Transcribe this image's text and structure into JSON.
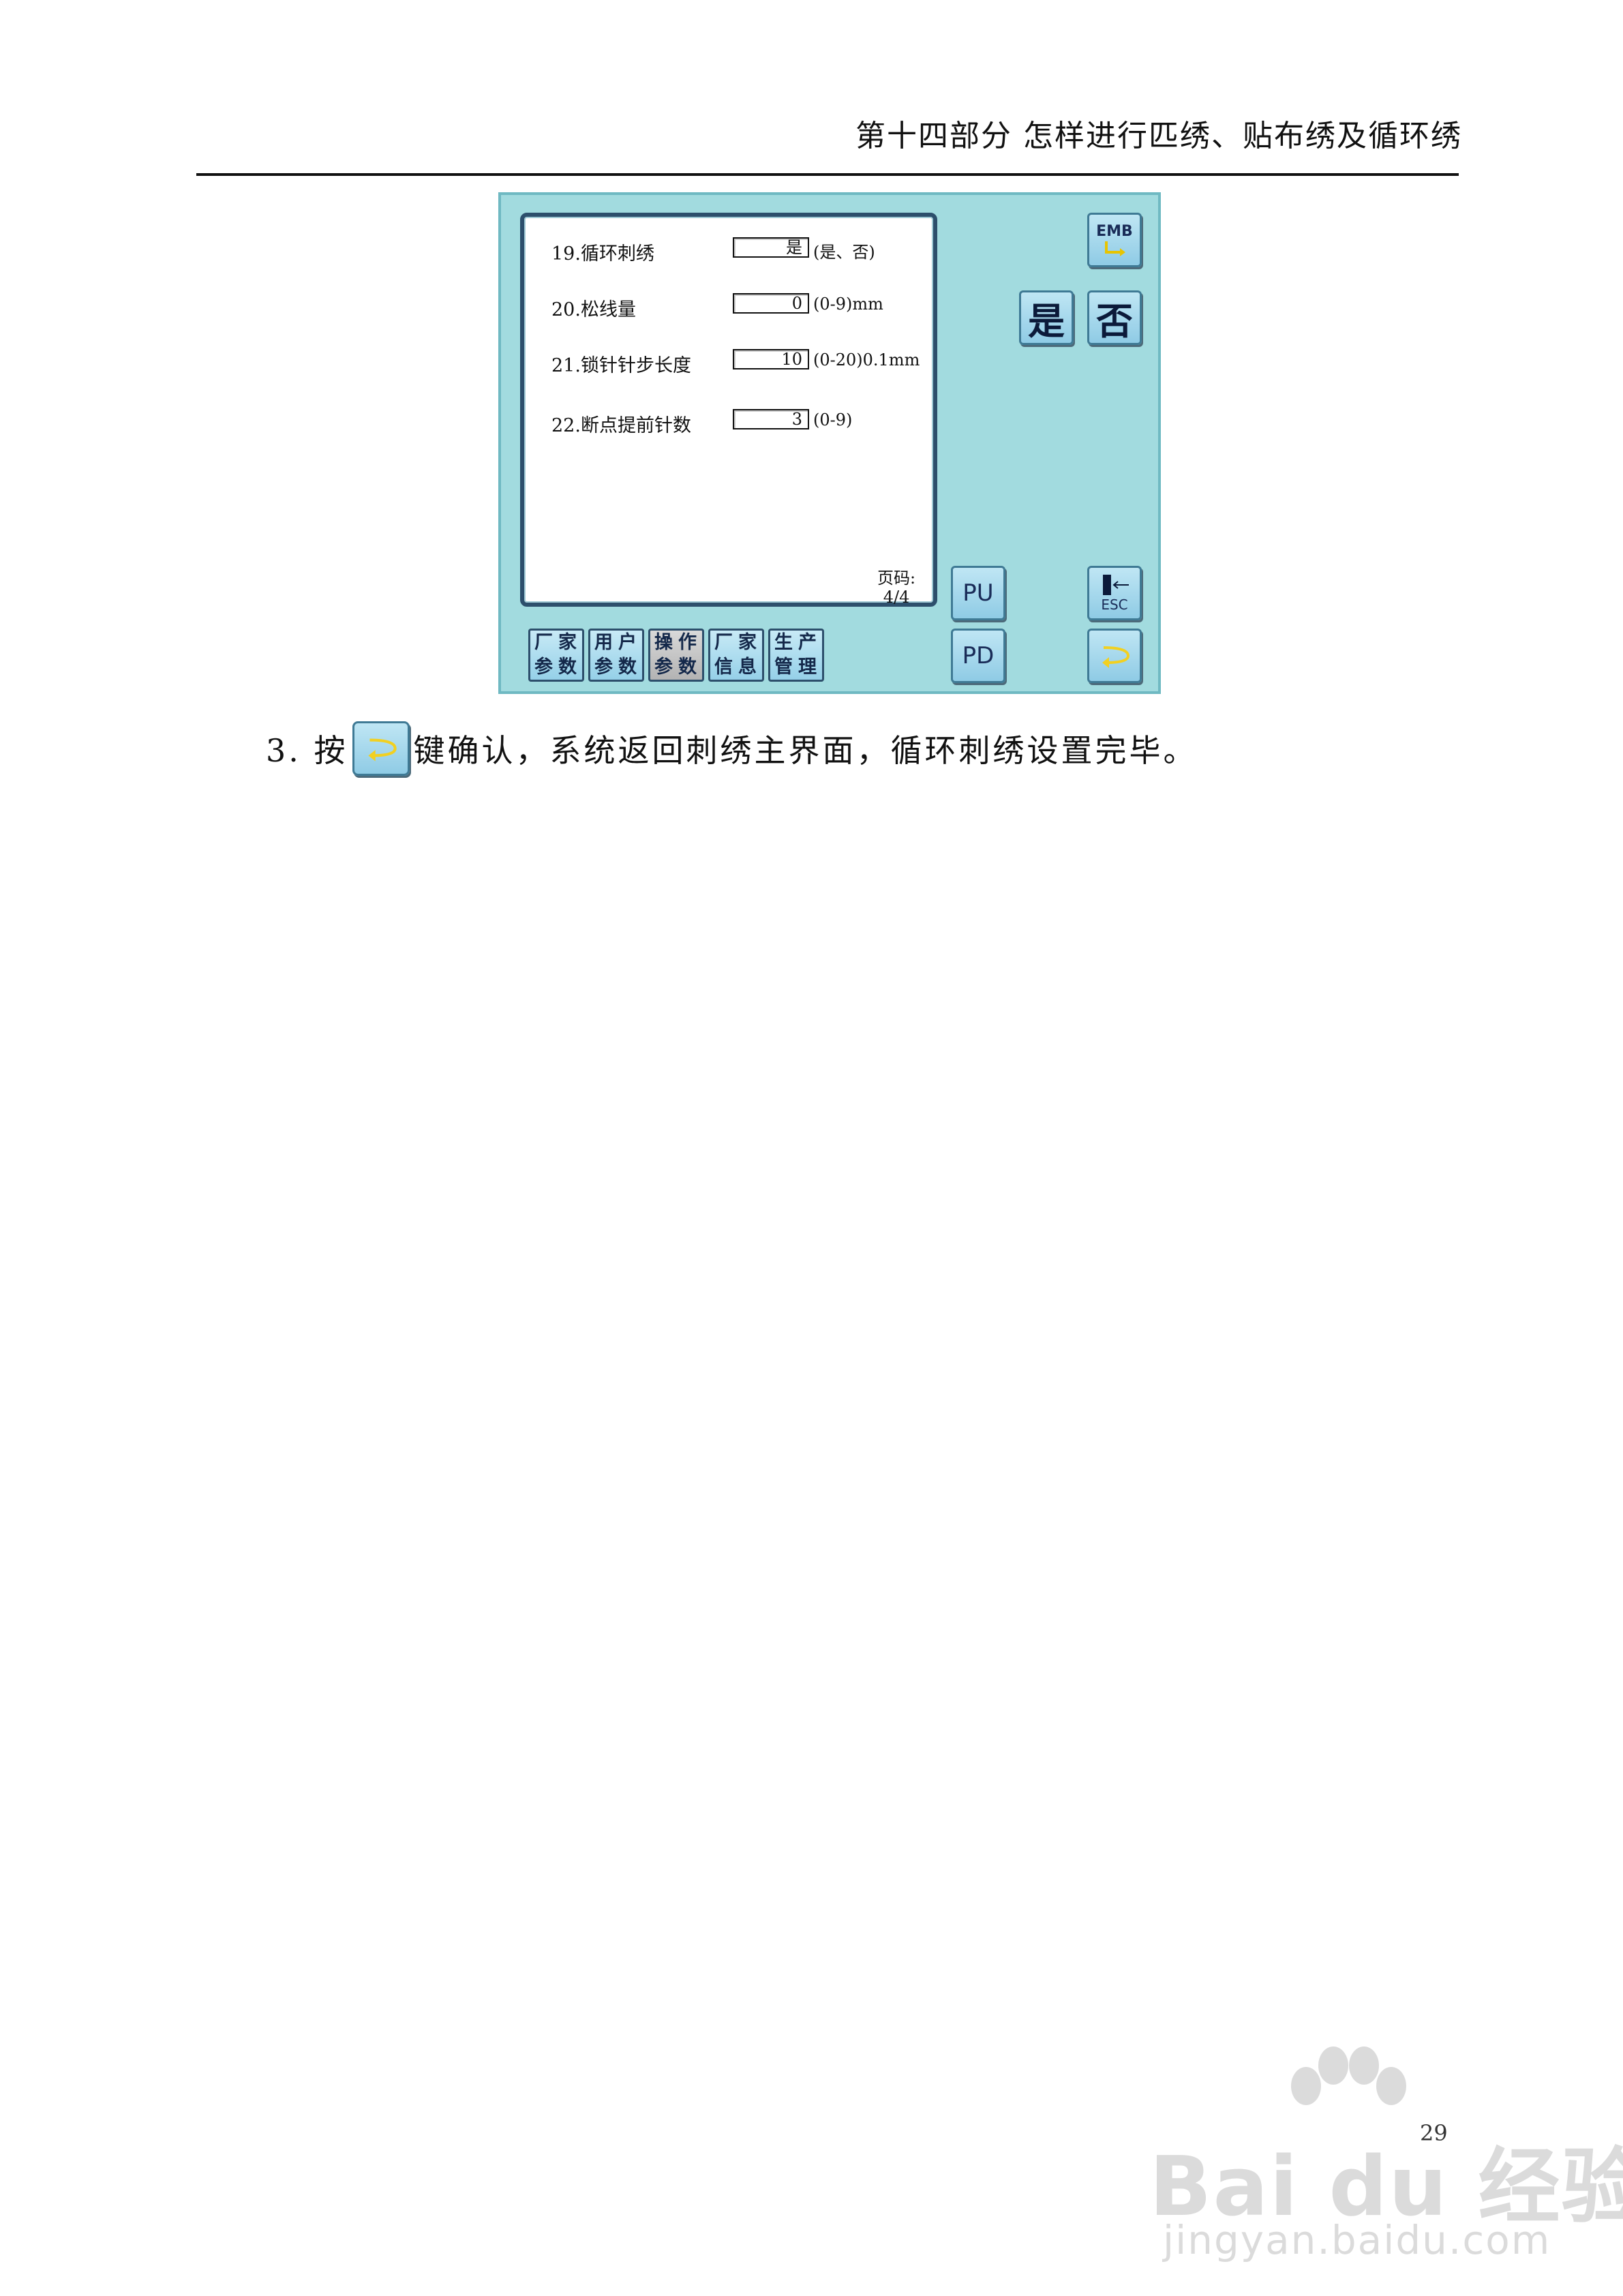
{
  "header": {
    "title": "第十四部分   怎样进行匹绣、贴布绣及循环绣"
  },
  "screen": {
    "params": [
      {
        "label": "19.循环刺绣",
        "value": "是",
        "range": "(是、否)"
      },
      {
        "label": "20.松线量",
        "value": "0",
        "range": "(0-9)mm"
      },
      {
        "label": "21.锁针针步长度",
        "value": "10",
        "range": "(0-20)0.1mm"
      },
      {
        "label": "22.断点提前针数",
        "value": "3",
        "range": "(0-9)"
      }
    ],
    "page_label": "页码:",
    "page_value": "4/4",
    "keys": {
      "emb": "EMB",
      "yes": "是",
      "no": "否",
      "pu": "PU",
      "pd": "PD",
      "esc": "ESC"
    },
    "tabs": [
      {
        "line1": "厂家",
        "line2": "参数"
      },
      {
        "line1": "用户",
        "line2": "参数"
      },
      {
        "line1": "操作",
        "line2": "参数"
      },
      {
        "line1": "厂家",
        "line2": "信息"
      },
      {
        "line1": "生产",
        "line2": "管理"
      }
    ]
  },
  "instruction": {
    "prefix": "3.  按",
    "suffix": "键确认，系统返回刺绣主界面，循环刺绣设置完毕。"
  },
  "page_number": "29",
  "watermark": {
    "main": "Bai du 经验",
    "sub": "jingyan.baidu.com"
  },
  "colors": {
    "screen_bg": "#a2dbdf",
    "key_bg": "#8fcbe5",
    "panel_border": "#2d4f6c",
    "arrow": "#f2d020"
  }
}
